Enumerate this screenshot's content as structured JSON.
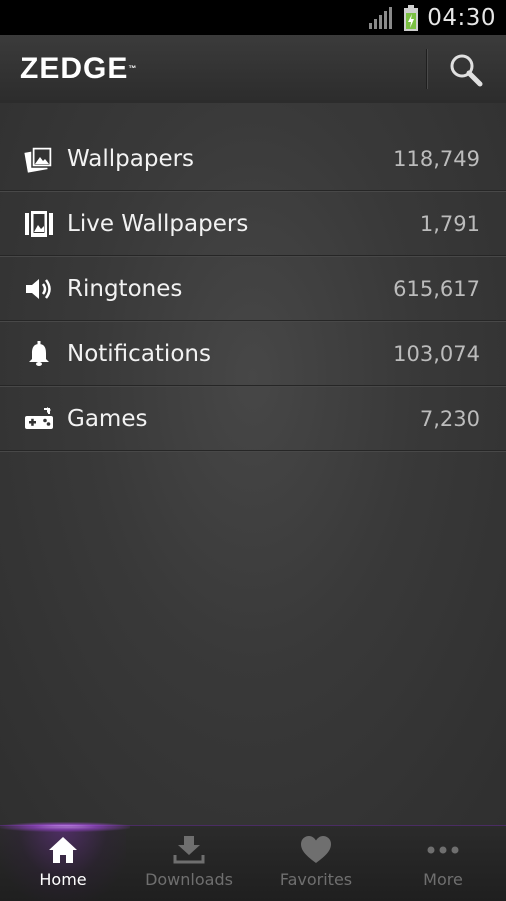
{
  "status_bar": {
    "time": "04:30"
  },
  "app_bar": {
    "logo_text": "ZEDGE",
    "logo_mark": "™"
  },
  "categories": [
    {
      "label": "Wallpapers",
      "count": "118,749",
      "icon": "wallpapers-icon"
    },
    {
      "label": "Live Wallpapers",
      "count": "1,791",
      "icon": "live-wallpapers-icon"
    },
    {
      "label": "Ringtones",
      "count": "615,617",
      "icon": "speaker-icon"
    },
    {
      "label": "Notifications",
      "count": "103,074",
      "icon": "bell-icon"
    },
    {
      "label": "Games",
      "count": "7,230",
      "icon": "gamepad-icon"
    }
  ],
  "tabs": [
    {
      "label": "Home",
      "icon": "home-icon",
      "active": true
    },
    {
      "label": "Downloads",
      "icon": "download-icon",
      "active": false
    },
    {
      "label": "Favorites",
      "icon": "heart-icon",
      "active": false
    },
    {
      "label": "More",
      "icon": "more-icon",
      "active": false
    }
  ],
  "colors": {
    "accent": "#9b4fd1",
    "background": "#3a3a3a",
    "battery": "#7bc043"
  }
}
